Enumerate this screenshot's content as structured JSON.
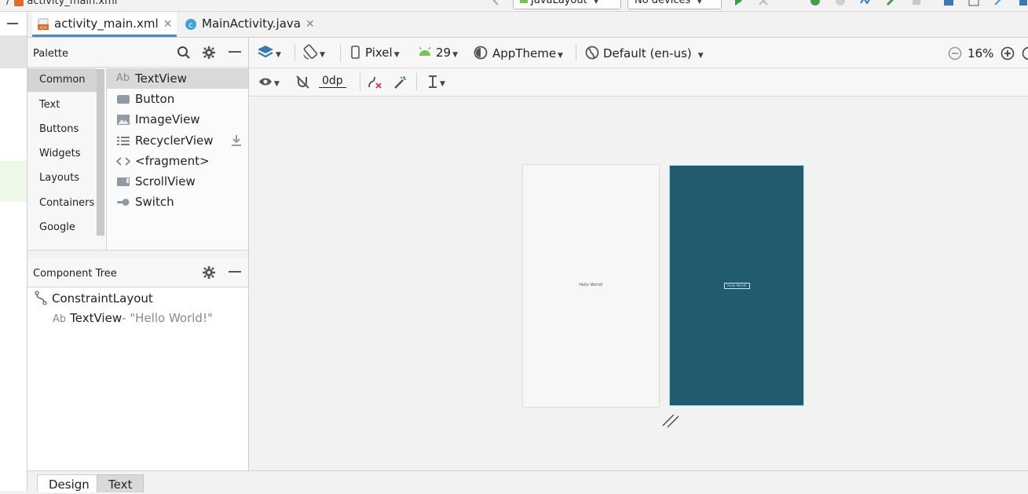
{
  "topbar": {
    "breadcrumb_file": "activity_main.xml",
    "layout_combo": "JavaLayout",
    "devices_combo": "No devices"
  },
  "editor_tabs": [
    {
      "label": "activity_main.xml",
      "icon": "xml-file-icon",
      "active": true
    },
    {
      "label": "MainActivity.java",
      "icon": "java-class-icon",
      "active": false
    }
  ],
  "palette": {
    "title": "Palette",
    "categories": [
      "Common",
      "Text",
      "Buttons",
      "Widgets",
      "Layouts",
      "Containers",
      "Google"
    ],
    "selected_category": "Common",
    "items": [
      {
        "label": "TextView",
        "icon": "textview-icon",
        "selected": true
      },
      {
        "label": "Button",
        "icon": "button-icon"
      },
      {
        "label": "ImageView",
        "icon": "imageview-icon"
      },
      {
        "label": "RecyclerView",
        "icon": "recyclerview-icon",
        "download": true
      },
      {
        "label": "<fragment>",
        "icon": "fragment-icon"
      },
      {
        "label": "ScrollView",
        "icon": "scrollview-icon"
      },
      {
        "label": "Switch",
        "icon": "switch-icon"
      }
    ]
  },
  "component_tree": {
    "title": "Component Tree",
    "root": "ConstraintLayout",
    "child_label": "TextView",
    "child_text": "- \"Hello World!\""
  },
  "toolbar": {
    "device": "Pixel",
    "api": "29",
    "theme": "AppTheme",
    "locale": "Default (en-us)",
    "zoom": "16%",
    "margin": "0dp"
  },
  "canvas": {
    "hello_text": "Hello World!",
    "blueprint_color": "#225b6d"
  },
  "bottom_tabs": [
    {
      "label": "Design",
      "active": true
    },
    {
      "label": "Text",
      "active": false
    }
  ],
  "colors": {
    "accent": "#4a88c7",
    "android_green": "#78c257",
    "xml_orange": "#e06b2c"
  }
}
